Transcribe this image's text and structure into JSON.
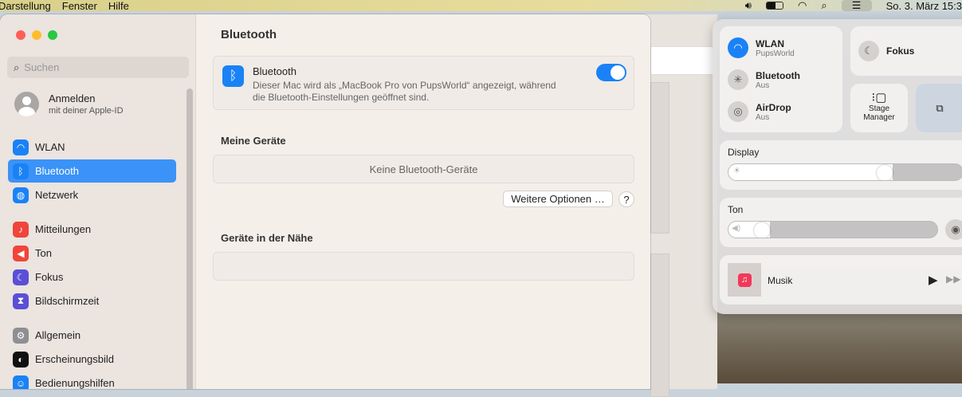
{
  "menubar": {
    "items": [
      "Darstellung",
      "Fenster",
      "Hilfe"
    ],
    "clock": "So. 3. März  15:3"
  },
  "sidebar": {
    "search_placeholder": "Suchen",
    "account": {
      "title": "Anmelden",
      "subtitle": "mit deiner Apple-ID"
    },
    "items": [
      {
        "label": "WLAN",
        "color": "#1a82f6",
        "icon": "wifi-icon",
        "glyph": "◠"
      },
      {
        "label": "Bluetooth",
        "color": "#1a82f6",
        "icon": "bluetooth-icon",
        "glyph": "ᛒ"
      },
      {
        "label": "Netzwerk",
        "color": "#1a82f6",
        "icon": "globe-icon",
        "glyph": "◍"
      },
      {
        "label": "Mitteilungen",
        "color": "#f0453a",
        "icon": "bell-icon",
        "glyph": "♪"
      },
      {
        "label": "Ton",
        "color": "#f0453a",
        "icon": "speaker-icon",
        "glyph": "◀"
      },
      {
        "label": "Fokus",
        "color": "#5a4fd6",
        "icon": "moon-icon",
        "glyph": "☾"
      },
      {
        "label": "Bildschirmzeit",
        "color": "#5a4fd6",
        "icon": "hourglass-icon",
        "glyph": "⧗"
      },
      {
        "label": "Allgemein",
        "color": "#8e8e93",
        "icon": "gear-icon",
        "glyph": "⚙"
      },
      {
        "label": "Erscheinungsbild",
        "color": "#111111",
        "icon": "appearance-icon",
        "glyph": "◐"
      },
      {
        "label": "Bedienungshilfen",
        "color": "#1a82f6",
        "icon": "accessibility-icon",
        "glyph": "☺"
      }
    ]
  },
  "main": {
    "title": "Bluetooth",
    "bt": {
      "label": "Bluetooth",
      "desc1": "Dieser Mac wird als „MacBook Pro von PupsWorld“ angezeigt, während",
      "desc2": "die Bluetooth-Einstellungen geöffnet sind.",
      "on": true
    },
    "my_devices": "Meine Geräte",
    "no_devices": "Keine Bluetooth-Geräte",
    "more_options": "Weitere Optionen …",
    "help": "?",
    "nearby": "Geräte in der Nähe"
  },
  "control_center": {
    "wlan": {
      "label": "WLAN",
      "sub": "PupsWorld"
    },
    "bluetooth": {
      "label": "Bluetooth",
      "sub": "Aus"
    },
    "airdrop": {
      "label": "AirDrop",
      "sub": "Aus"
    },
    "focus": "Fokus",
    "stage1": "Stage",
    "stage2": "Manager",
    "display": "Display",
    "display_level": 0.7,
    "sound": "Ton",
    "sound_level": 0.2,
    "music": "Musik"
  }
}
